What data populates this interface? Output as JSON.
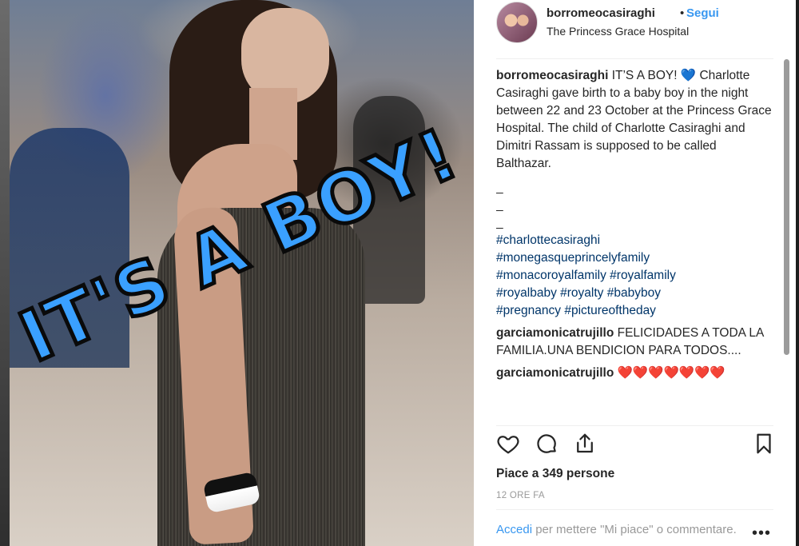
{
  "post": {
    "image_text": "IT'S A BOY!",
    "author": "borromeocasiraghi",
    "dot": "•",
    "follow_label": "Segui",
    "location": "The Princess Grace Hospital"
  },
  "caption": {
    "username": "borromeocasiraghi",
    "text": "IT’S A BOY! 💙 Charlotte Casiraghi gave birth to a baby boy in the night between 22 and 23 October at the Princess Grace Hospital. The child of Charlotte Casiraghi and Dimitri Rassam is supposed to be called Balthazar.",
    "dashes": [
      "_",
      "_",
      "_"
    ],
    "hashtags": [
      "#charlottecasiraghi",
      "#monegasqueprincelyfamily",
      "#monacoroyalfamily",
      "#royalfamily",
      "#royalbaby",
      "#royalty",
      "#babyboy",
      "#pregnancy",
      "#pictureoftheday"
    ]
  },
  "comments": [
    {
      "username": "garciamonicatrujillo",
      "text": "FELICIDADES A TODA LA FAMILIA.UNA BENDICION PARA TODOS...."
    },
    {
      "username": "garciamonicatrujillo",
      "text": "❤️❤️❤️❤️❤️❤️❤️"
    }
  ],
  "actions": {
    "icons": [
      "heart-icon",
      "comment-icon",
      "share-icon",
      "bookmark-icon"
    ]
  },
  "likes_text": "Piace a 349 persone",
  "timestamp": "12 ORE FA",
  "login_prompt": {
    "link": "Accedi",
    "text": " per mettere \"Mi piace\" o commentare."
  },
  "colors": {
    "accent": "#3897f0",
    "hashtag": "#003569",
    "text": "#262626",
    "muted": "#999999",
    "overlay_text": "#3aa0ff"
  }
}
